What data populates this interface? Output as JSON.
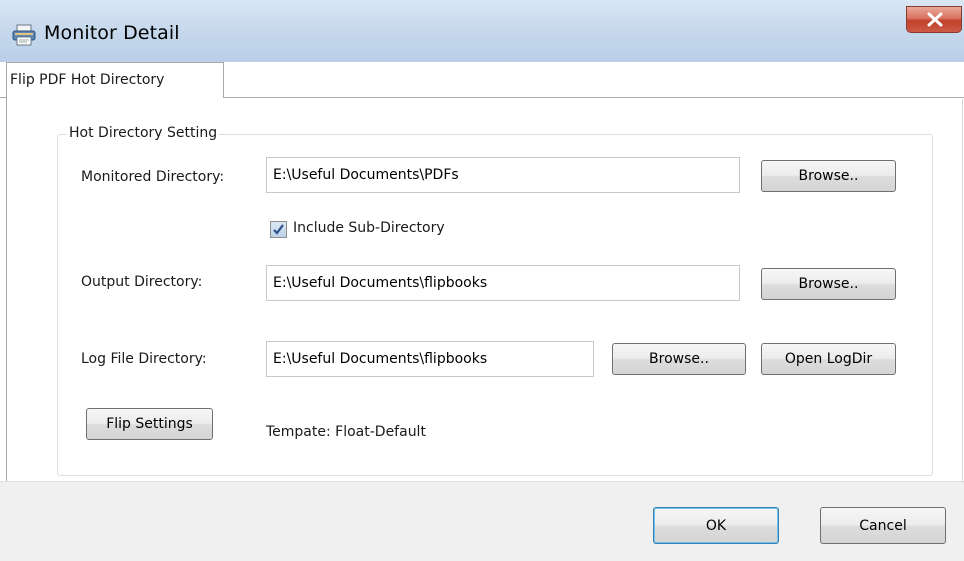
{
  "window": {
    "title": "Monitor Detail",
    "icon": "printer-icon",
    "close_icon": "close-icon"
  },
  "tabs": [
    {
      "label": "Flip PDF Hot Directory",
      "selected": true
    }
  ],
  "group": {
    "title": "Hot Directory Setting"
  },
  "monitored": {
    "label": "Monitored Directory:",
    "value": "E:\\Useful Documents\\PDFs",
    "browse_label": "Browse.."
  },
  "include_sub": {
    "label": "Include Sub-Directory",
    "checked": true
  },
  "output": {
    "label": "Output Directory:",
    "value": "E:\\Useful Documents\\flipbooks",
    "browse_label": "Browse.."
  },
  "log": {
    "label": "Log File Directory:",
    "value": "E:\\Useful Documents\\flipbooks",
    "browse_label": "Browse..",
    "open_label": "Open LogDir"
  },
  "flip_settings": {
    "button_label": "Flip Settings",
    "template_text": "Tempate: Float-Default"
  },
  "footer": {
    "ok_label": "OK",
    "cancel_label": "Cancel"
  },
  "colors": {
    "titlebar": "#c6d8ec",
    "close_button": "#c2402a",
    "footer": "#f0f0f0"
  }
}
